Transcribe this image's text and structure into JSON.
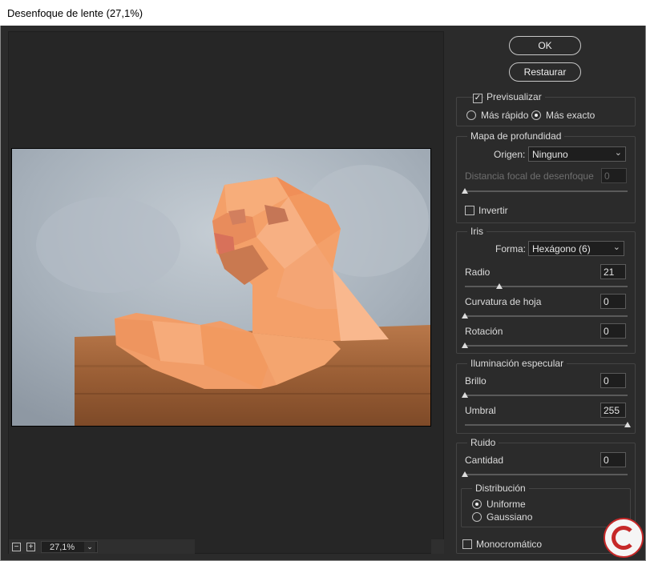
{
  "window": {
    "title": "Desenfoque de lente (27,1%)"
  },
  "buttons": {
    "ok": "OK",
    "reset": "Restaurar"
  },
  "preview": {
    "checkbox_label": "Previsualizar",
    "checked": true,
    "fast_label": "Más rápido",
    "accurate_label": "Más exacto",
    "selected_mode": "Más exacto"
  },
  "depth_map": {
    "legend": "Mapa de profundidad",
    "source_label": "Origen:",
    "source_value": "Ninguno",
    "focal_label": "Distancia focal de desenfoque",
    "focal_value": "0",
    "invert_label": "Invertir",
    "invert_checked": false
  },
  "iris": {
    "legend": "Iris",
    "shape_label": "Forma:",
    "shape_value": "Hexágono (6)",
    "radius_label": "Radio",
    "radius_value": "21",
    "radius_fraction": 0.21,
    "curvature_label": "Curvatura de hoja",
    "curvature_value": "0",
    "rotation_label": "Rotación",
    "rotation_value": "0"
  },
  "specular": {
    "legend": "Iluminación especular",
    "brightness_label": "Brillo",
    "brightness_value": "0",
    "threshold_label": "Umbral",
    "threshold_value": "255",
    "threshold_fraction": 1.0
  },
  "noise": {
    "legend": "Ruido",
    "amount_label": "Cantidad",
    "amount_value": "0",
    "distribution_legend": "Distribución",
    "uniform_label": "Uniforme",
    "gaussian_label": "Gaussiano",
    "selected_distribution": "Uniforme",
    "mono_label": "Monocromático",
    "mono_checked": false
  },
  "zoom": {
    "minus": "−",
    "plus": "+",
    "value": "27,1%",
    "chevron": "⌄"
  }
}
